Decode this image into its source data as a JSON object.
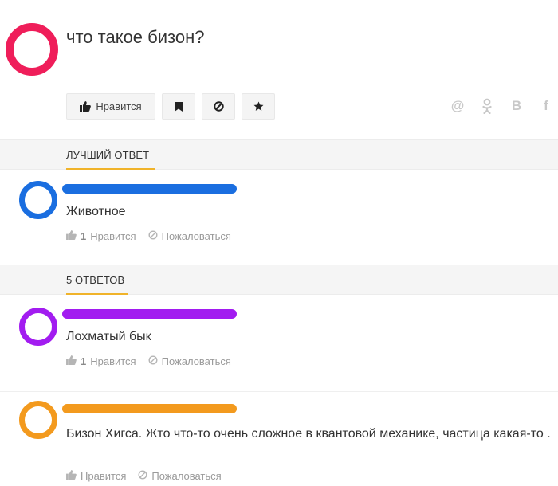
{
  "question": {
    "title": "что такое бизон?",
    "avatar_color": "#ef1e5a"
  },
  "actions": {
    "like_label": "Нравится",
    "icons": [
      "thumbs-up-icon",
      "bookmark-icon",
      "block-icon",
      "star-icon"
    ]
  },
  "share": {
    "icons": [
      "at-icon",
      "odnoklassniki-icon",
      "vk-icon",
      "facebook-icon"
    ],
    "glyphs": {
      "at": "@",
      "ok": "⚲",
      "vk": "B",
      "fb": "f"
    }
  },
  "best_answer": {
    "section_label": "ЛУЧШИЙ ОТВЕТ",
    "accent_color": "#f0b32a",
    "answer": {
      "avatar_color": "#1a6ee0",
      "name_bar_color": "#1a6ee0",
      "text": "Животное",
      "likes_count": "1",
      "like_label": "Нравится",
      "report_label": "Пожаловаться"
    }
  },
  "answers_section": {
    "section_label": "5 ОТВЕТОВ",
    "answers": [
      {
        "avatar_color": "#a21cf0",
        "name_bar_color": "#a21cf0",
        "text": "Лохматый бык",
        "likes_count": "1",
        "like_label": "Нравится",
        "report_label": "Пожаловаться"
      },
      {
        "avatar_color": "#f39a1e",
        "name_bar_color": "#f39a1e",
        "text": "Бизон Хигса. Жто что-то очень сложное в квантовой механике, частица какая-то .",
        "likes_count": "",
        "like_label": "Нравится",
        "report_label": "Пожаловаться"
      }
    ]
  }
}
